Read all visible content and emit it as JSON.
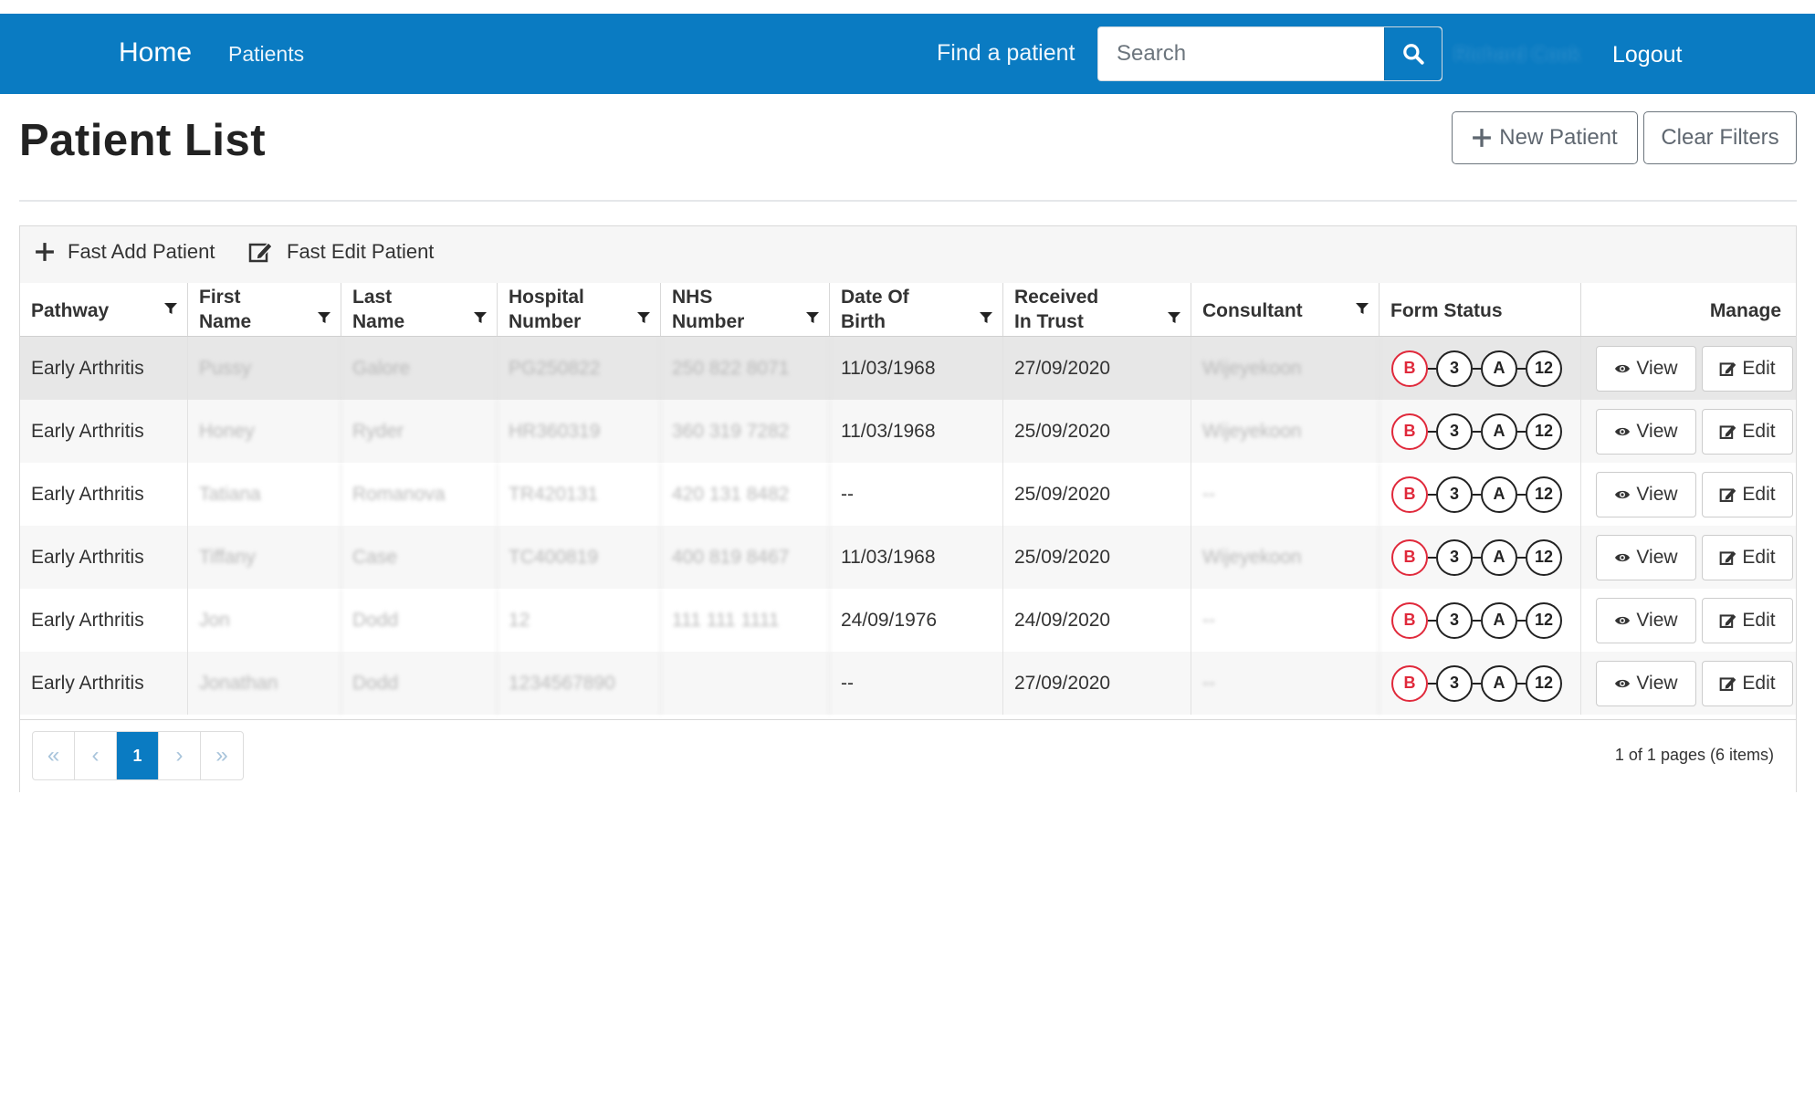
{
  "nav": {
    "home": "Home",
    "patients": "Patients",
    "find_label": "Find a patient",
    "search_placeholder": "Search",
    "user": "Richard Cook",
    "logout": "Logout"
  },
  "page": {
    "title": "Patient List",
    "new_patient": "New Patient",
    "clear_filters": "Clear Filters"
  },
  "toolbar": {
    "fast_add": "Fast Add Patient",
    "fast_edit": "Fast Edit Patient"
  },
  "columns": {
    "pathway": "Pathway",
    "first_name": [
      "First",
      "Name"
    ],
    "last_name": [
      "Last",
      "Name"
    ],
    "hospital_number": [
      "Hospital",
      "Number"
    ],
    "nhs_number": [
      "NHS",
      "Number"
    ],
    "dob": [
      "Date Of",
      "Birth"
    ],
    "received": [
      "Received",
      "In Trust"
    ],
    "consultant": "Consultant",
    "form_status": "Form Status",
    "manage": "Manage"
  },
  "rows": [
    {
      "pathway": "Early Arthritis",
      "first": "Pussy",
      "last": "Galore",
      "hosp": "PG250822",
      "nhs": "250 822 8071",
      "dob": "11/03/1968",
      "received": "27/09/2020",
      "consultant": "Wijeyekoon"
    },
    {
      "pathway": "Early Arthritis",
      "first": "Honey",
      "last": "Ryder",
      "hosp": "HR360319",
      "nhs": "360 319 7282",
      "dob": "11/03/1968",
      "received": "25/09/2020",
      "consultant": "Wijeyekoon"
    },
    {
      "pathway": "Early Arthritis",
      "first": "Tatiana",
      "last": "Romanova",
      "hosp": "TR420131",
      "nhs": "420 131 8482",
      "dob": "--",
      "received": "25/09/2020",
      "consultant": "--"
    },
    {
      "pathway": "Early Arthritis",
      "first": "Tiffany",
      "last": "Case",
      "hosp": "TC400819",
      "nhs": "400 819 8467",
      "dob": "11/03/1968",
      "received": "25/09/2020",
      "consultant": "Wijeyekoon"
    },
    {
      "pathway": "Early Arthritis",
      "first": "Jon",
      "last": "Dodd",
      "hosp": "12",
      "nhs": "111 111 1111",
      "dob": "24/09/1976",
      "received": "24/09/2020",
      "consultant": "--"
    },
    {
      "pathway": "Early Arthritis",
      "first": "Jonathan",
      "last": "Dodd",
      "hosp": "1234567890",
      "nhs": "",
      "dob": "--",
      "received": "27/09/2020",
      "consultant": "--"
    }
  ],
  "form_badges": [
    "B",
    "3",
    "A",
    "12"
  ],
  "manage": {
    "view": "View",
    "edit": "Edit"
  },
  "pager": {
    "first": "«",
    "prev": "‹",
    "current": "1",
    "next": "›",
    "last": "»",
    "info": "1 of 1 pages (6 items)"
  },
  "colors": {
    "brand": "#0a7bc2",
    "badge_red": "#e0293b"
  }
}
